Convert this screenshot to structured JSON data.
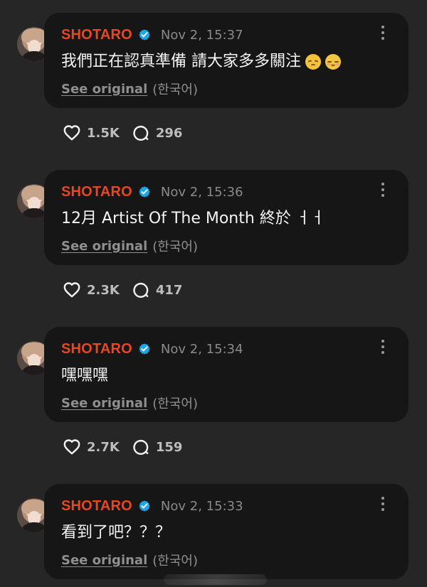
{
  "feed": {
    "posts": [
      {
        "author": "SHOTARO",
        "timestamp": "Nov 2, 15:37",
        "content": "我們正在認真準備 請大家多多關注",
        "emojis": [
          "pensive-face",
          "relieved-face"
        ],
        "see_original": "See original",
        "language": "(한국어)",
        "likes": "1.5K",
        "comments": "296"
      },
      {
        "author": "SHOTARO",
        "timestamp": "Nov 2, 15:36",
        "content": "12月 Artist Of The Month 終於 ㅓㅓ",
        "emojis": [],
        "see_original": "See original",
        "language": "(한국어)",
        "likes": "2.3K",
        "comments": "417"
      },
      {
        "author": "SHOTARO",
        "timestamp": "Nov 2, 15:34",
        "content": "嘿嘿嘿",
        "emojis": [],
        "see_original": "See original",
        "language": "(한국어)",
        "likes": "2.7K",
        "comments": "159"
      },
      {
        "author": "SHOTARO",
        "timestamp": "Nov 2, 15:33",
        "content": "看到了吧？？？",
        "emojis": [],
        "see_original": "See original",
        "language": "(한국어)",
        "likes": "",
        "comments": ""
      }
    ]
  },
  "icons": {
    "verified": "verified-badge-icon",
    "more": "more-options-icon",
    "like": "heart-icon",
    "comment": "comment-bubble-icon",
    "avatar": "profile-avatar"
  },
  "colors": {
    "background": "#262626",
    "card": "#161616",
    "username": "#e8471f",
    "verified": "#1ea7e8",
    "muted_text": "#8f8f8f"
  }
}
